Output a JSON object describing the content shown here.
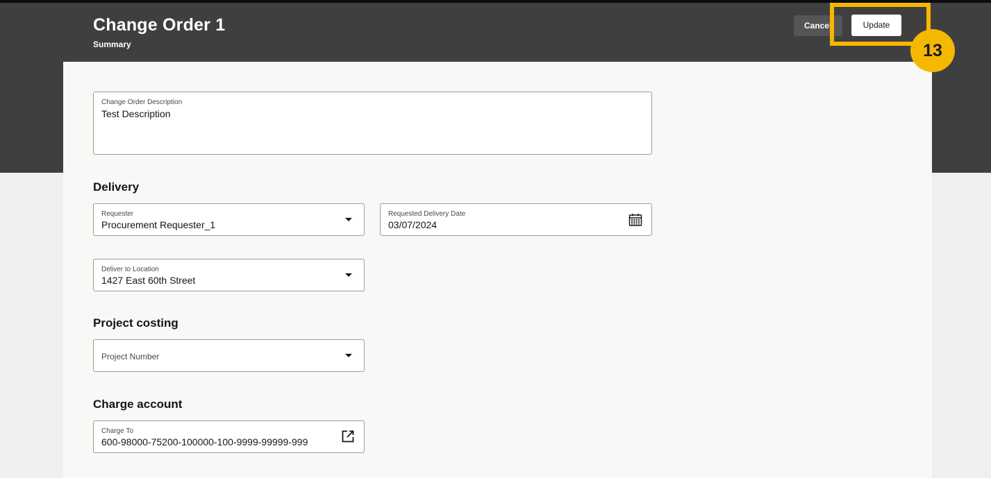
{
  "header": {
    "title": "Change Order 1",
    "subtitle": "Summary",
    "cancel_label": "Cancel",
    "update_label": "Update"
  },
  "callout": {
    "step": "13",
    "color": "#f5b800"
  },
  "description": {
    "label": "Change Order Description",
    "value": "Test Description"
  },
  "delivery": {
    "title": "Delivery",
    "requester": {
      "label": "Requester",
      "value": "Procurement Requester_1"
    },
    "requested_date": {
      "label": "Requested Delivery Date",
      "value": "03/07/2024"
    },
    "location": {
      "label": "Deliver to Location",
      "value": "1427 East 60th Street"
    }
  },
  "project_costing": {
    "title": "Project costing",
    "project_number": {
      "placeholder": "Project Number"
    }
  },
  "charge_account": {
    "title": "Charge account",
    "charge_to": {
      "label": "Charge To",
      "value": "600-98000-75200-100000-100-9999-99999-999"
    }
  },
  "icons": {
    "requester_dropdown": "chevron-down-icon",
    "date_picker": "calendar-icon",
    "location_dropdown": "chevron-down-icon",
    "project_dropdown": "chevron-down-icon",
    "charge_to_open": "external-link-icon"
  },
  "colors": {
    "header_bg": "#3f3f3f",
    "page_bg": "#f0efed",
    "card_bg": "#f9f8f6",
    "highlight": "#f5b800"
  }
}
